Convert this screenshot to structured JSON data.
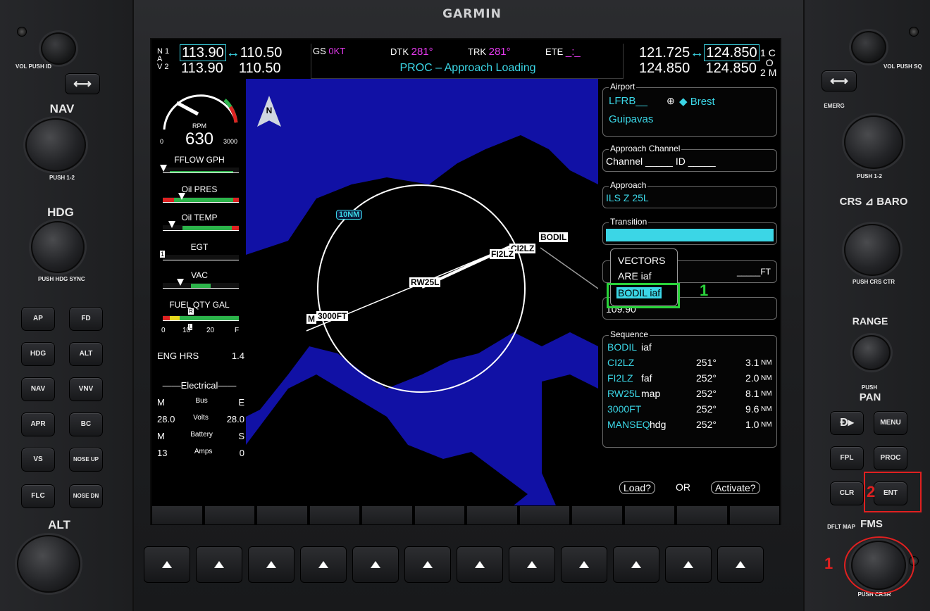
{
  "brand": "GARMIN",
  "nav": {
    "label_n": "N",
    "label_a": "A",
    "label_v": "V",
    "row1_num": "1",
    "row2_num": "2",
    "active1": "113.90",
    "standby1": "110.50",
    "active2": "113.90",
    "standby2": "110.50"
  },
  "com": {
    "active1": "121.725",
    "standby1": "124.850",
    "active2": "124.850",
    "standby2": "124.850",
    "row1_num": "1",
    "row2_num": "2",
    "label_c": "C",
    "label_o": "O",
    "label_m": "M"
  },
  "topcenter": {
    "gs_label": "GS",
    "gs_value": "0KT",
    "dtk_label": "DTK",
    "dtk_value": "281°",
    "trk_label": "TRK",
    "trk_value": "281°",
    "ete_label": "ETE",
    "ete_value": "_:_",
    "status": "PROC – Approach Loading"
  },
  "eis": {
    "rpm_label": "RPM",
    "rpm_value": "630",
    "rpm_min": "0",
    "rpm_max": "3000",
    "fflow": "FFLOW GPH",
    "oil_pres": "Oil PRES",
    "oil_temp": "Oil TEMP",
    "egt": "EGT",
    "egt_marker": "1",
    "vac": "VAC",
    "fuel": "FUEL QTY GAL",
    "fuel_ticks": [
      "0",
      "10",
      "20",
      "F"
    ],
    "fuel_marker_r": "R",
    "fuel_marker_l": "L",
    "eng_hrs_label": "ENG HRS",
    "eng_hrs_value": "1.4",
    "electrical": "Electrical",
    "bus_m": "M",
    "bus_label": "Bus",
    "bus_e": "E",
    "volts_l": "28.0",
    "volts_label": "Volts",
    "volts_r": "28.0",
    "bat_m": "M",
    "bat_label": "Battery",
    "bat_s": "S",
    "amps_l": "13",
    "amps_label": "Amps",
    "amps_r": "0"
  },
  "map": {
    "north": "N",
    "range_label": "10NM",
    "wpts": [
      "BODIL",
      "CI2LZ",
      "FI2LZ",
      "RW25L",
      "3000FT",
      "M"
    ]
  },
  "fpl": {
    "airport_title": "Airport",
    "airport_id": "LFRB__",
    "airport_city": "Brest",
    "airport_name": "Guipavas",
    "channel_title": "Approach Channel",
    "channel_text": "Channel _____ ID _____",
    "approach_title": "Approach",
    "approach_value": "ILS Z 25L",
    "transition_title": "Transition",
    "ft_placeholder": "_____FT",
    "freq_value": "109.90",
    "sequence_title": "Sequence",
    "sequence": [
      {
        "wpt": "BODIL",
        "suffix": "iaf",
        "crs": "",
        "dist": "",
        "unit": ""
      },
      {
        "wpt": "CI2LZ",
        "suffix": "",
        "crs": "251°",
        "dist": "3.1",
        "unit": "NM"
      },
      {
        "wpt": "FI2LZ",
        "suffix": "faf",
        "crs": "252°",
        "dist": "2.0",
        "unit": "NM"
      },
      {
        "wpt": "RW25L",
        "suffix": "map",
        "crs": "252°",
        "dist": "8.1",
        "unit": "NM"
      },
      {
        "wpt": "3000FT",
        "suffix": "",
        "crs": "252°",
        "dist": "9.6",
        "unit": "NM"
      },
      {
        "wpt": "MANSEQ",
        "suffix": "hdg",
        "crs": "252°",
        "dist": "1.0",
        "unit": "NM"
      }
    ],
    "load_label": "Load?",
    "or_label": "OR",
    "activate_label": "Activate?"
  },
  "popup": {
    "items": [
      "VECTORS",
      "ARE iaf",
      "BODIL iaf"
    ]
  },
  "left_controls": {
    "vol": "VOL",
    "push": "PUSH",
    "id": "ID",
    "nav": "NAV",
    "push12": "PUSH 1-2",
    "hdg": "HDG",
    "push_hdg_sync": "PUSH HDG SYNC",
    "alt": "ALT",
    "buttons": [
      "AP",
      "FD",
      "HDG",
      "ALT",
      "NAV",
      "VNV",
      "APR",
      "BC",
      "VS",
      "NOSE UP",
      "FLC",
      "NOSE DN"
    ]
  },
  "right_controls": {
    "vol": "VOL",
    "push": "PUSH",
    "sq": "SQ",
    "emerg": "EMERG",
    "push12": "PUSH 1-2",
    "crs": "CRS",
    "baro": "BARO",
    "push_crs_ctr": "PUSH CRS CTR",
    "range": "RANGE",
    "push_pan": "PUSH",
    "pan": "PAN",
    "menu": "MENU",
    "fpl": "FPL",
    "proc": "PROC",
    "clr": "CLR",
    "ent": "ENT",
    "dflt_map": "DFLT MAP",
    "fms": "FMS",
    "push_crsr": "PUSH CRSR"
  },
  "annotations": {
    "step1": "1",
    "step2": "2",
    "green1": "1"
  }
}
